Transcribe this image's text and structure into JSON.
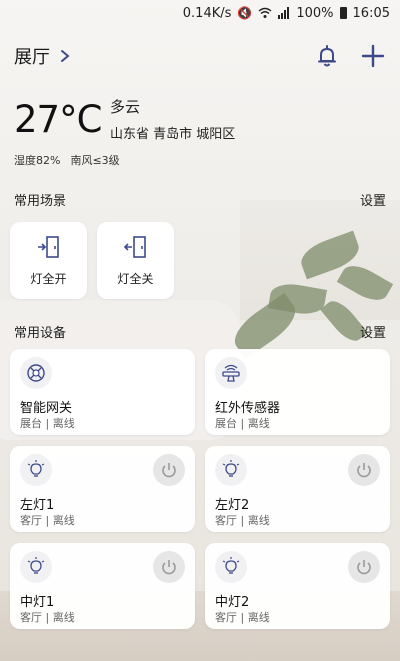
{
  "status_bar": {
    "speed": "0.14K/s",
    "battery": "100%",
    "time": "16:05"
  },
  "header": {
    "room": "展厅"
  },
  "weather": {
    "temp": "27°C",
    "condition": "多云",
    "location": "山东省 青岛市 城阳区",
    "humidity": "湿度82%",
    "wind": "南风≤3级"
  },
  "scenes": {
    "title": "常用场景",
    "settings": "设置",
    "items": [
      {
        "label": "灯全开",
        "icon": "door-open-icon"
      },
      {
        "label": "灯全关",
        "icon": "door-close-icon"
      }
    ]
  },
  "devices": {
    "title": "常用设备",
    "settings": "设置",
    "items": [
      {
        "name": "智能网关",
        "location": "展台",
        "state": "离线",
        "icon": "gateway-icon"
      },
      {
        "name": "红外传感器",
        "location": "展台",
        "state": "离线",
        "icon": "infrared-sensor-icon"
      },
      {
        "name": "左灯1",
        "location": "客厅",
        "state": "离线",
        "icon": "bulb-icon"
      },
      {
        "name": "左灯2",
        "location": "客厅",
        "state": "离线",
        "icon": "bulb-icon"
      },
      {
        "name": "中灯1",
        "location": "客厅",
        "state": "离线",
        "icon": "bulb-icon"
      },
      {
        "name": "中灯2",
        "location": "客厅",
        "state": "离线",
        "icon": "bulb-icon"
      }
    ],
    "separator": " | "
  },
  "colors": {
    "accent_icon": "#3d4a8a",
    "card": "#ffffff",
    "power_bg": "#e6e6e6"
  }
}
